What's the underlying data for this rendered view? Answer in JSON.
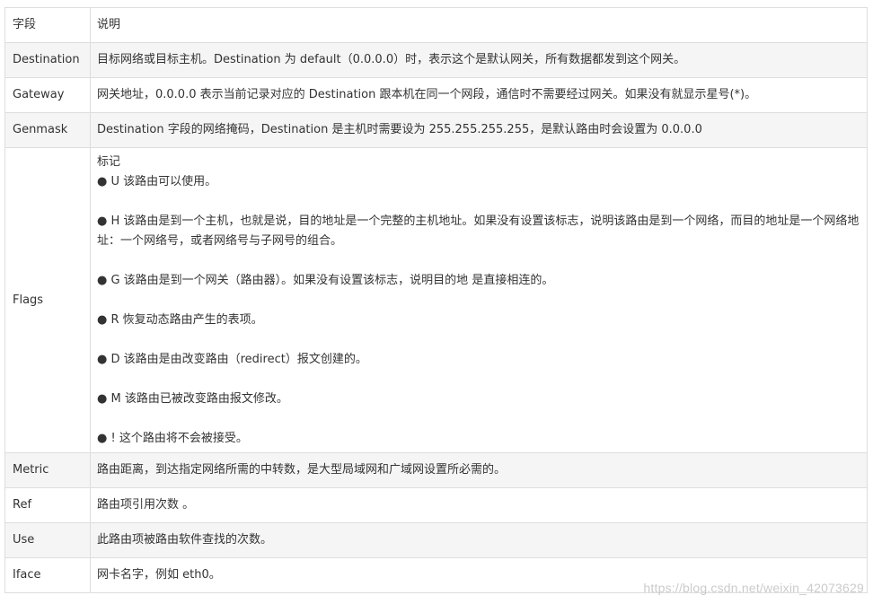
{
  "header": {
    "field": "字段",
    "description": "说明"
  },
  "rows": [
    {
      "field": "Destination",
      "description": "目标网络或目标主机。Destination 为 default（0.0.0.0）时，表示这个是默认网关，所有数据都发到这个网关。"
    },
    {
      "field": "Gateway",
      "description": "网关地址，0.0.0.0 表示当前记录对应的 Destination 跟本机在同一个网段，通信时不需要经过网关。如果没有就显示星号(*)。"
    },
    {
      "field": "Genmask",
      "description": "Destination 字段的网络掩码，Destination 是主机时需要设为 255.255.255.255，是默认路由时会设置为 0.0.0.0"
    }
  ],
  "flags": {
    "field": "Flags",
    "title": "标记",
    "items": [
      "● U 该路由可以使用。",
      "● H 该路由是到一个主机，也就是说，目的地址是一个完整的主机地址。如果没有设置该标志，说明该路由是到一个网络，而目的地址是一个网络地址：一个网络号，或者网络号与子网号的组合。",
      "● G 该路由是到一个网关（路由器）。如果没有设置该标志，说明目的地 是直接相连的。",
      "● R 恢复动态路由产生的表项。",
      "● D 该路由是由改变路由（redirect）报文创建的。",
      "● M 该路由已被改变路由报文修改。",
      "● ! 这个路由将不会被接受。"
    ]
  },
  "rows_after": [
    {
      "field": "Metric",
      "description": "路由距离，到达指定网络所需的中转数，是大型局域网和广域网设置所必需的。"
    },
    {
      "field": "Ref",
      "description": "路由项引用次数 。"
    },
    {
      "field": "Use",
      "description": "此路由项被路由软件查找的次数。"
    },
    {
      "field": "Iface",
      "description": "网卡名字，例如 eth0。"
    }
  ],
  "watermark": "https://blog.csdn.net/weixin_42073629",
  "colors": {
    "border": "#dddddd",
    "alt_row_bg": "#f5f5f5",
    "text": "#333333"
  }
}
